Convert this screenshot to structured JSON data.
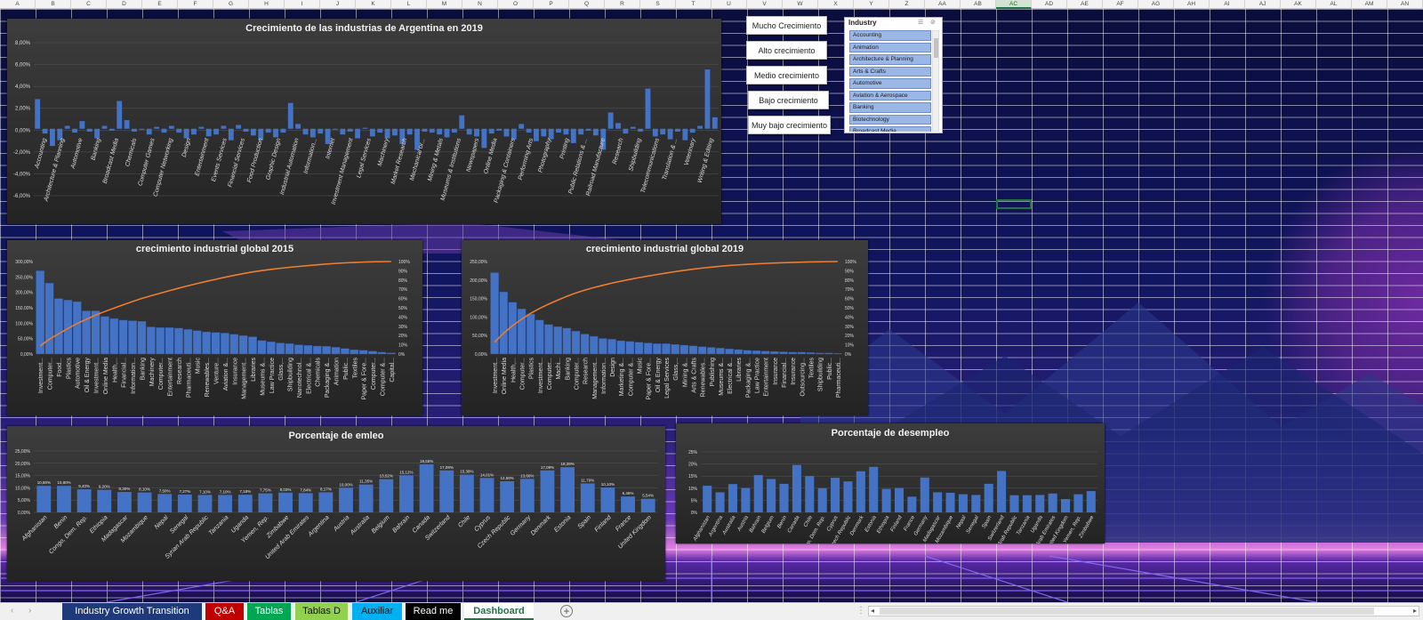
{
  "columns": [
    "A",
    "B",
    "C",
    "D",
    "E",
    "F",
    "G",
    "H",
    "I",
    "J",
    "K",
    "L",
    "M",
    "N",
    "O",
    "P",
    "Q",
    "R",
    "S",
    "T",
    "U",
    "V",
    "W",
    "X",
    "Y",
    "Z",
    "AA",
    "AB",
    "AC",
    "AD",
    "AE",
    "AF",
    "AG",
    "AH",
    "AI",
    "AJ",
    "AK",
    "AL",
    "AM",
    "AN"
  ],
  "selected_column": "AC",
  "buttons": [
    "Mucho Crecimiento",
    "Alto crecimiento",
    "Medio crecimiento",
    "Bajo crecimiento",
    "Muy bajo crecimiento"
  ],
  "slicer": {
    "title": "Industry",
    "items": [
      "Accounting",
      "Animation",
      "Architecture & Planning",
      "Arts & Crafts",
      "Automotive",
      "Aviation & Aerospace",
      "Banking",
      "Biotechnology",
      "Broadcast Media"
    ]
  },
  "tabs": {
    "items": [
      {
        "label": "Industry Growth Transition",
        "color": "#1f3a7a"
      },
      {
        "label": "Q&A",
        "color": "#c00000"
      },
      {
        "label": "Tablas",
        "color": "#00a651"
      },
      {
        "label": "Tablas D",
        "color": "#92d050"
      },
      {
        "label": "Auxiliar",
        "color": "#00b0f0"
      },
      {
        "label": "Read me",
        "color": "#000000"
      },
      {
        "label": "Dashboard",
        "color": "#ffffff",
        "active": true
      }
    ],
    "add": "+"
  },
  "chart_data": [
    {
      "type": "bar",
      "title": "Crecimiento de las industrias de Argentina en 2019",
      "ylim": [
        -0.07,
        0.09
      ],
      "yticks": [
        "8,00%",
        "6,00%",
        "4,00%",
        "2,00%",
        "0,00%",
        "-2,00%",
        "-4,00%",
        "-6,00%"
      ],
      "categories": [
        "Accounting",
        "Architecture & Planning",
        "Automotive",
        "Banking",
        "Broadcast Media",
        "Chemicals",
        "Computer Games",
        "Computer Networking",
        "Design",
        "Entertainment",
        "Events Services",
        "Financial Services",
        "Food Production",
        "Graphic Design",
        "Industrial Automation",
        "Information...",
        "Internet",
        "Investment Management",
        "Legal Services",
        "Machinery",
        "Market Research",
        "Mechanical or...",
        "Mining & Metals",
        "Museums & Institutions",
        "Newspapers",
        "Online Media",
        "Packaging & Containers",
        "Performing Arts",
        "Photography",
        "Printing",
        "Public Relations & ...",
        "Railroad Manufacture",
        "Research",
        "Shipbuilding",
        "Telecommunications",
        "Translation & ...",
        "Veterinary",
        "Writing & Editing"
      ],
      "values": [
        0.031,
        -0.005,
        -0.018,
        -0.012,
        0.003,
        -0.004,
        0.008,
        -0.003,
        -0.01,
        0.003,
        -0.002,
        0.029,
        0.009,
        -0.003,
        -0.001,
        -0.006,
        0.002,
        -0.004,
        0.003,
        -0.004,
        -0.01,
        -0.006,
        0.002,
        -0.008,
        -0.006,
        0.003,
        -0.012,
        0.004,
        -0.003,
        -0.007,
        -0.012,
        -0.004,
        -0.009,
        -0.004,
        0.027,
        0.005,
        -0.006,
        -0.009,
        -0.005,
        -0.016,
        -0.001,
        -0.006,
        -0.003,
        -0.01,
        0.001,
        -0.008,
        -0.004,
        -0.01,
        -0.007,
        -0.016,
        -0.006,
        -0.022,
        -0.003,
        -0.004,
        -0.006,
        -0.009,
        -0.004,
        0.014,
        -0.006,
        -0.008,
        -0.02,
        -0.005,
        -0.002,
        -0.008,
        -0.011,
        0.005,
        -0.004,
        -0.013,
        -0.008,
        -0.011,
        -0.004,
        -0.006,
        -0.015,
        -0.006,
        -0.002,
        -0.007,
        -0.022,
        0.017,
        0.006,
        -0.005,
        0.002,
        -0.003,
        0.042,
        -0.008,
        -0.006,
        -0.011,
        -0.003,
        -0.012,
        -0.004,
        0.003,
        0.062,
        0.012
      ]
    },
    {
      "type": "pareto",
      "title": "crecimiento industrial global 2015",
      "ylim": [
        0,
        300
      ],
      "y2lim": [
        0,
        100
      ],
      "yticks": [
        "300,00%",
        "250,00%",
        "200,00%",
        "150,00%",
        "100,00%",
        "50,00%",
        "0,00%"
      ],
      "y2ticks": [
        "100%",
        "90%",
        "80%",
        "70%",
        "60%",
        "50%",
        "40%",
        "30%",
        "20%",
        "10%",
        "0%"
      ],
      "labels": [
        "Investment...",
        "Computer...",
        "Food...",
        "Plastics",
        "Automotive",
        "Oil & Energy",
        "Investment...",
        "Online Media",
        "Health,...",
        "Financial...",
        "Information...",
        "Banking",
        "Machinery",
        "Computer...",
        "Entertainment",
        "Research",
        "Pharmaceuti...",
        "Music",
        "Renewables...",
        "Venture...",
        "Aviation &...",
        "Insurance",
        "Management...",
        "Libraries",
        "Museums &...",
        "Law Practice",
        "Glass,...",
        "Shipbuilding",
        "Nanotechnol...",
        "Electrical &...",
        "Chemicals",
        "Packaging &...",
        "Animation",
        "Public...",
        "Textiles",
        "Paper & Fore...",
        "Computer...",
        "Computer &...",
        "Capital..."
      ],
      "values": [
        270,
        230,
        180,
        175,
        170,
        140,
        140,
        122,
        115,
        110,
        108,
        106,
        88,
        86,
        86,
        84,
        80,
        76,
        72,
        70,
        68,
        64,
        60,
        56,
        44,
        40,
        36,
        34,
        30,
        28,
        26,
        25,
        22,
        18,
        14,
        12,
        9,
        6,
        4
      ]
    },
    {
      "type": "pareto",
      "title": "crecimiento industrial global 2019",
      "ylim": [
        0,
        250
      ],
      "y2lim": [
        0,
        100
      ],
      "yticks": [
        "250,00%",
        "200,00%",
        "150,00%",
        "100,00%",
        "50,00%",
        "0,00%"
      ],
      "y2ticks": [
        "100%",
        "90%",
        "80%",
        "70%",
        "60%",
        "50%",
        "40%",
        "30%",
        "20%",
        "10%",
        "0%"
      ],
      "labels": [
        "Investment...",
        "Online Media",
        "Health,...",
        "Computer...",
        "Plastics",
        "Investment...",
        "Computer...",
        "Machi...",
        "Banking",
        "Computer...",
        "Research",
        "Management...",
        "Information...",
        "Design",
        "Marketing &...",
        "Computer &...",
        "Music",
        "Paper & Fore...",
        "Oil & Energy",
        "Legal Services",
        "Glass,...",
        "Mining &...",
        "Arts & Crafts",
        "Renewables...",
        "Publishing",
        "Museums &...",
        "Electrical &...",
        "Libraries",
        "Packaging &...",
        "Law Practice",
        "Entertainment",
        "Insurance",
        "Financial...",
        "Insurance",
        "Outsourcing...",
        "Textiles",
        "Shipbuilding",
        "Public...",
        "Pharmaceuti..."
      ],
      "values": [
        220,
        168,
        140,
        122,
        108,
        92,
        80,
        74,
        70,
        62,
        54,
        48,
        42,
        40,
        36,
        34,
        32,
        30,
        28,
        28,
        26,
        24,
        22,
        20,
        18,
        16,
        14,
        12,
        10,
        9,
        8,
        7,
        6,
        5,
        5,
        4,
        3,
        3,
        2
      ]
    },
    {
      "type": "bar",
      "title": "Porcentaje de emleo",
      "ylim": [
        0,
        0.25
      ],
      "yticks": [
        "25,00%",
        "20,00%",
        "15,00%",
        "10,00%",
        "5,00%",
        "0,00%"
      ],
      "categories": [
        "Afghanistan",
        "Benin",
        "Congo, Dem. Rep.",
        "Ethiopia",
        "Madagascar",
        "Mozambique",
        "Nepal",
        "Senegal",
        "Syrian Arab Republic",
        "Tanzania",
        "Uganda",
        "Yemen, Rep.",
        "Zimbabwe",
        "United Arab Emirates",
        "Argentina",
        "Austria",
        "Australia",
        "Belgium",
        "Bahrain",
        "Canada",
        "Switzerland",
        "Chile",
        "Cyprus",
        "Czech Republic",
        "Germany",
        "Denmark",
        "Estonia",
        "Spain",
        "Finland",
        "France",
        "United Kingdom"
      ],
      "labels": [
        "10,80%",
        "10,80%",
        "9,40%",
        "9,20%",
        "8,30%",
        "8,10%",
        "7,50%",
        "7,27%",
        "7,10%",
        "7,10%",
        "7,18%",
        "7,75%",
        "8,03%",
        "7,84%",
        "8,17%",
        "10,00%",
        "11,35%",
        "13,52%",
        "15,12%",
        "19,55%",
        "17,09%",
        "15,38%",
        "14,01%",
        "12,69%",
        "13,66%",
        "17,09%",
        "18,39%",
        "11,79%",
        "10,10%",
        "6,46%",
        "5,54%"
      ],
      "values": [
        0.108,
        0.108,
        0.094,
        0.092,
        0.083,
        0.081,
        0.075,
        0.0727,
        0.071,
        0.071,
        0.0718,
        0.0775,
        0.0803,
        0.0784,
        0.0817,
        0.1,
        0.1135,
        0.1352,
        0.1512,
        0.1955,
        0.1709,
        0.1538,
        0.1401,
        0.1269,
        0.1366,
        0.1709,
        0.1839,
        0.1179,
        0.101,
        0.0646,
        0.0554
      ]
    },
    {
      "type": "bar",
      "title": "Porcentaje de desempleo",
      "ylim": [
        0,
        0.25
      ],
      "yticks": [
        "25%",
        "20%",
        "15%",
        "10%",
        "5%",
        "0%"
      ],
      "categories": [
        "Afghanistan",
        "Argentina",
        "Australia",
        "Austria",
        "Bahrain",
        "Belgium",
        "Benin",
        "Canada",
        "Chile",
        "Congo, Dem. Rep.",
        "Cyprus",
        "Czech Republic",
        "Denmark",
        "Estonia",
        "Ethiopia",
        "Finland",
        "France",
        "Germany",
        "Madagascar",
        "Mozambique",
        "Nepal",
        "Senegal",
        "Spain",
        "Switzerland",
        "Syrian Arab Republic",
        "Tanzania",
        "Uganda",
        "United Arab Emirates",
        "United Kingdom",
        "Yemen, Rep.",
        "Zimbabwe"
      ],
      "values": [
        0.11,
        0.083,
        0.117,
        0.101,
        0.154,
        0.138,
        0.118,
        0.196,
        0.15,
        0.1,
        0.143,
        0.128,
        0.17,
        0.188,
        0.097,
        0.101,
        0.065,
        0.144,
        0.083,
        0.081,
        0.075,
        0.072,
        0.118,
        0.171,
        0.071,
        0.071,
        0.072,
        0.078,
        0.055,
        0.075,
        0.088
      ]
    }
  ]
}
